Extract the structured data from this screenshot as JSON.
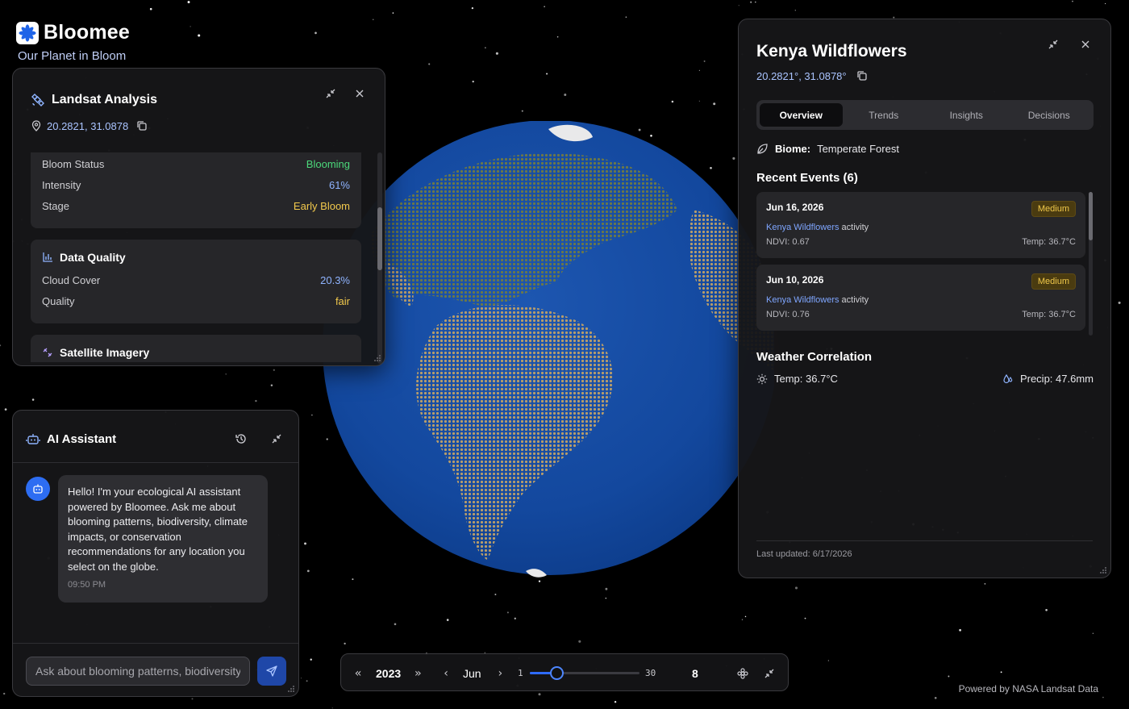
{
  "brand": {
    "name": "Bloomee",
    "tagline": "Our Planet in Bloom",
    "accent": "#2d6df2"
  },
  "landsat": {
    "title": "Landsat Analysis",
    "coords": "20.2821, 31.0878",
    "bloom": {
      "rows": [
        {
          "label": "Bloom Status",
          "value": "Blooming",
          "color": "#4cd97b"
        },
        {
          "label": "Intensity",
          "value": "61%",
          "color": "#8fb4ff"
        },
        {
          "label": "Stage",
          "value": "Early Bloom",
          "color": "#f2c94c"
        }
      ]
    },
    "quality": {
      "title": "Data Quality",
      "rows": [
        {
          "label": "Cloud Cover",
          "value": "20.3%",
          "color": "#8fb4ff"
        },
        {
          "label": "Quality",
          "value": "fair",
          "color": "#f2c94c"
        }
      ]
    },
    "imagery_title": "Satellite Imagery"
  },
  "assistant": {
    "title": "AI Assistant",
    "message": "Hello! I'm your ecological AI assistant powered by Bloomee. Ask me about blooming patterns, biodiversity, climate impacts, or conservation recommendations for any location you select on the globe.",
    "time": "09:50 PM",
    "input_placeholder": "Ask about blooming patterns, biodiversity..."
  },
  "timeline": {
    "year": "2023",
    "month": "Jun",
    "range_min": "1",
    "range_max": "30",
    "day": "8",
    "day_fraction": 0.24
  },
  "kenya": {
    "title": "Kenya Wildflowers",
    "coords": "20.2821°, 31.0878°",
    "tabs": [
      {
        "label": "Overview",
        "active": true
      },
      {
        "label": "Trends",
        "active": false
      },
      {
        "label": "Insights",
        "active": false
      },
      {
        "label": "Decisions",
        "active": false
      }
    ],
    "biome_label": "Biome:",
    "biome_value": "Temperate Forest",
    "events_title": "Recent Events (6)",
    "events": [
      {
        "date": "Jun 16, 2026",
        "severity": "Medium",
        "location": "Kenya Wildflowers",
        "activity": "activity",
        "ndvi": "NDVI: 0.67",
        "temp": "Temp: 36.7°C"
      },
      {
        "date": "Jun 10, 2026",
        "severity": "Medium",
        "location": "Kenya Wildflowers",
        "activity": "activity",
        "ndvi": "NDVI: 0.76",
        "temp": "Temp: 36.7°C"
      }
    ],
    "weather_title": "Weather Correlation",
    "weather_temp": "Temp: 36.7°C",
    "weather_precip": "Precip: 47.6mm",
    "updated": "Last updated: 6/17/2026"
  },
  "footer": {
    "note": "Powered by NASA Landsat Data"
  }
}
